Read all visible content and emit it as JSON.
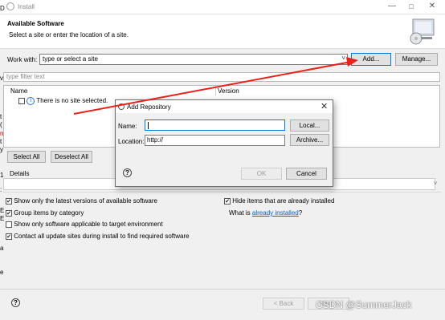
{
  "window": {
    "title": "Install"
  },
  "header": {
    "title": "Available Software",
    "subtitle": "Select a site or enter the location of a site."
  },
  "work_with": {
    "label": "Work with:",
    "value": "type or select a site",
    "add_label": "Add...",
    "manage_label": "Manage..."
  },
  "filter": {
    "placeholder": "type filter text"
  },
  "table": {
    "columns": [
      "Name",
      "Version"
    ],
    "rows": [
      {
        "label": "There is no site selected."
      }
    ]
  },
  "buttons": {
    "select_all": "Select All",
    "deselect_all": "Deselect All"
  },
  "details": {
    "label": "Details"
  },
  "options": {
    "latest_versions": "Show only the latest versions of available software",
    "hide_installed": "Hide items that are already installed",
    "group_by_category": "Group items by category",
    "what_is_prefix": "What is ",
    "what_is_link": "already installed",
    "what_is_suffix": "?",
    "target_env": "Show only software applicable to target environment",
    "contact_sites": "Contact all update sites during install to find required software"
  },
  "footer": {
    "back": "< Back",
    "next": "Next >",
    "watermark": "CSDN @SummerJack"
  },
  "dialog": {
    "title": "Add Repository",
    "name_label": "Name:",
    "name_value": "",
    "local_label": "Local...",
    "location_label": "Location:",
    "location_value": "http://",
    "archive_label": "Archive...",
    "ok_label": "OK",
    "cancel_label": "Cancel"
  },
  "left_fragments": [
    "D",
    "v",
    "t",
    "(",
    "n",
    "t",
    "y",
    "1",
    ":",
    "E",
    "E",
    "a",
    "e"
  ],
  "colors": {
    "accent": "#0078d7",
    "link": "#0066cc",
    "arrow": "#e8211b"
  }
}
